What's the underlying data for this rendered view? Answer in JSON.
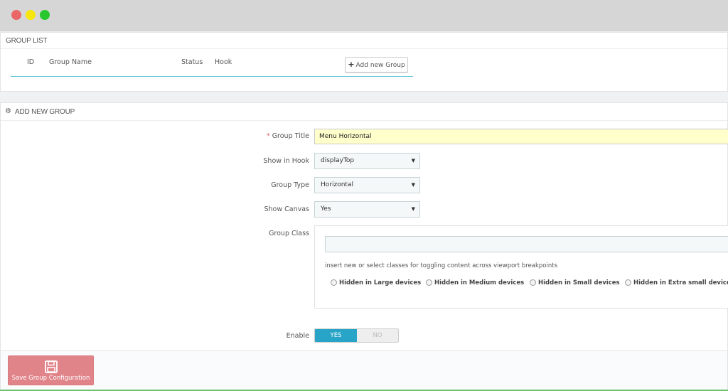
{
  "window": {
    "controls": [
      "close",
      "minimize",
      "maximize"
    ]
  },
  "group_list": {
    "heading": "GROUP LIST",
    "columns": [
      "ID",
      "Group Name",
      "Status",
      "Hook"
    ],
    "add_button": {
      "icon": "plus-icon",
      "label": "Add new Group"
    }
  },
  "add_new_group": {
    "heading": "ADD NEW GROUP",
    "heading_icon": "gears-icon",
    "fields": {
      "group_title": {
        "required_mark": "*",
        "label": "Group Title",
        "value": "Menu Horizontal"
      },
      "show_in_hook": {
        "label": "Show in Hook",
        "value": "displayTop"
      },
      "group_type": {
        "label": "Group Type",
        "value": "Horizontal"
      },
      "show_canvas": {
        "label": "Show Canvas",
        "value": "Yes"
      },
      "group_class": {
        "label": "Group Class",
        "value": "",
        "help": "insert new or select classes for toggling content across viewport breakpoints",
        "options": [
          "Hidden in Large devices",
          "Hidden in Medium devices",
          "Hidden in Small devices",
          "Hidden in Extra small devices"
        ]
      },
      "enable": {
        "label": "Enable",
        "yes": "YES",
        "no": "NO",
        "selected": "YES"
      }
    },
    "save_button": {
      "icon": "save-icon",
      "label": "Save Group Configuration"
    }
  },
  "colors": {
    "accent": "#27a4c7",
    "save_button": "#e0848a",
    "required": "#e05e5e",
    "title_input_bg": "#ffffcc"
  }
}
